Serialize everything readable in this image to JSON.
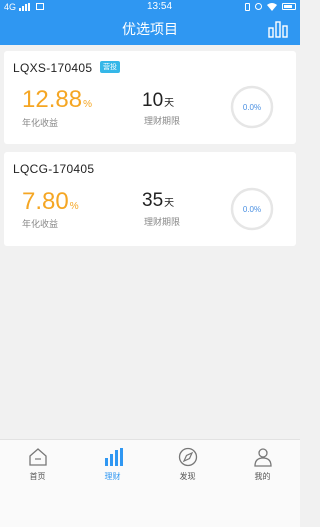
{
  "status_bar": {
    "network": "4G",
    "time": "13:54"
  },
  "nav": {
    "title": "优选项目",
    "right_icon": "bar-chart-icon"
  },
  "products": [
    {
      "name": "LQXS-170405",
      "tag": "营投",
      "rate": "12.88",
      "rate_unit": "%",
      "rate_label": "年化收益",
      "term": "10",
      "term_unit": "天",
      "term_label": "理财期限",
      "progress_text": "0.0%",
      "progress": 0
    },
    {
      "name": "LQCG-170405",
      "rate": "7.80",
      "rate_unit": "%",
      "rate_label": "年化收益",
      "term": "35",
      "term_unit": "天",
      "term_label": "理财期限",
      "progress_text": "0.0%",
      "progress": 0
    }
  ],
  "tabs": [
    {
      "label": "首页",
      "icon": "home-icon",
      "active": false
    },
    {
      "label": "理财",
      "icon": "chart-icon",
      "active": true
    },
    {
      "label": "发现",
      "icon": "compass-icon",
      "active": false
    },
    {
      "label": "我的",
      "icon": "user-icon",
      "active": false
    }
  ],
  "colors": {
    "primary": "#2f97f2",
    "rate": "#f5a623",
    "tag": "#35b7e8"
  }
}
